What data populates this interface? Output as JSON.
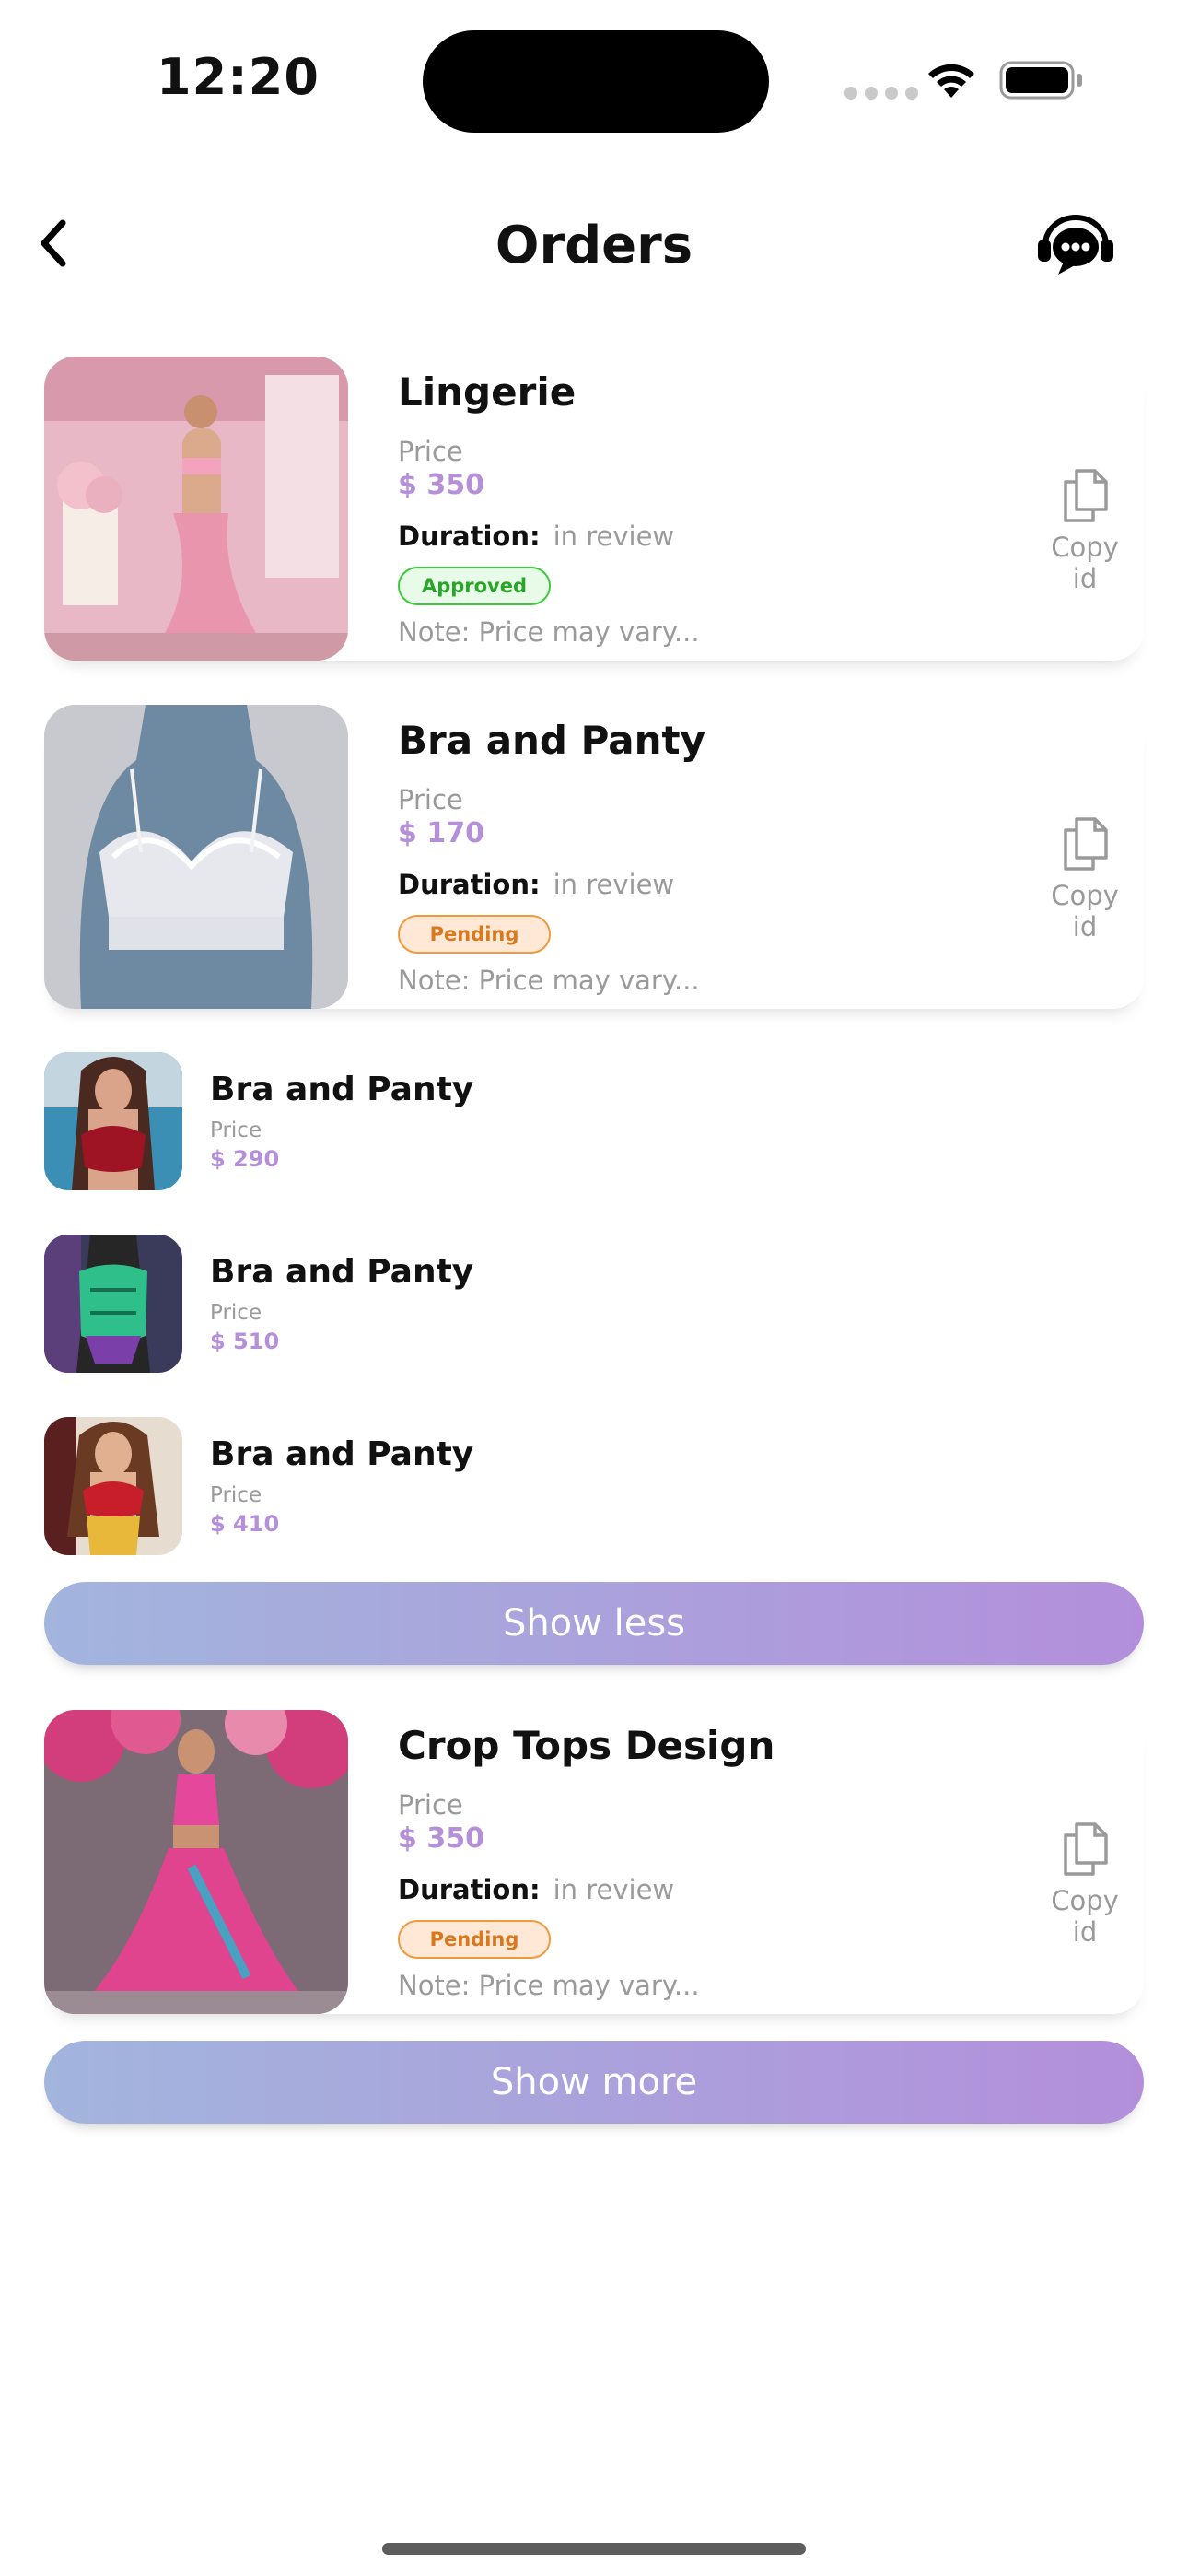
{
  "status_bar": {
    "time": "12:20"
  },
  "header": {
    "title": "Orders",
    "back_icon": "chevron-left-icon",
    "support_icon": "headset-chat-icon"
  },
  "orders": [
    {
      "title": "Lingerie",
      "price_label": "Price",
      "price": "$ 350",
      "duration_label": "Duration:",
      "duration_value": "in review",
      "status": "Approved",
      "note": "Note: Price may vary...",
      "copy_label": "Copy id"
    },
    {
      "title": "Bra and Panty",
      "price_label": "Price",
      "price": "$ 170",
      "duration_label": "Duration:",
      "duration_value": "in review",
      "status": "Pending",
      "note": "Note: Price may vary...",
      "copy_label": "Copy id"
    },
    {
      "title": "Crop Tops Design",
      "price_label": "Price",
      "price": "$ 350",
      "duration_label": "Duration:",
      "duration_value": "in review",
      "status": "Pending",
      "note": "Note: Price may vary...",
      "copy_label": "Copy id"
    }
  ],
  "sub_items": [
    {
      "title": "Bra and Panty",
      "price_label": "Price",
      "price": "$ 290"
    },
    {
      "title": "Bra and Panty",
      "price_label": "Price",
      "price": "$ 510"
    },
    {
      "title": "Bra and Panty",
      "price_label": "Price",
      "price": "$ 410"
    }
  ],
  "buttons": {
    "show_less": "Show less",
    "show_more": "Show more"
  },
  "colors": {
    "accent_price": "#b58fd8",
    "gradient_start": "#a2b5dd",
    "gradient_end": "#b38fdb",
    "approved": "#2aa52a",
    "pending": "#d8791d"
  }
}
